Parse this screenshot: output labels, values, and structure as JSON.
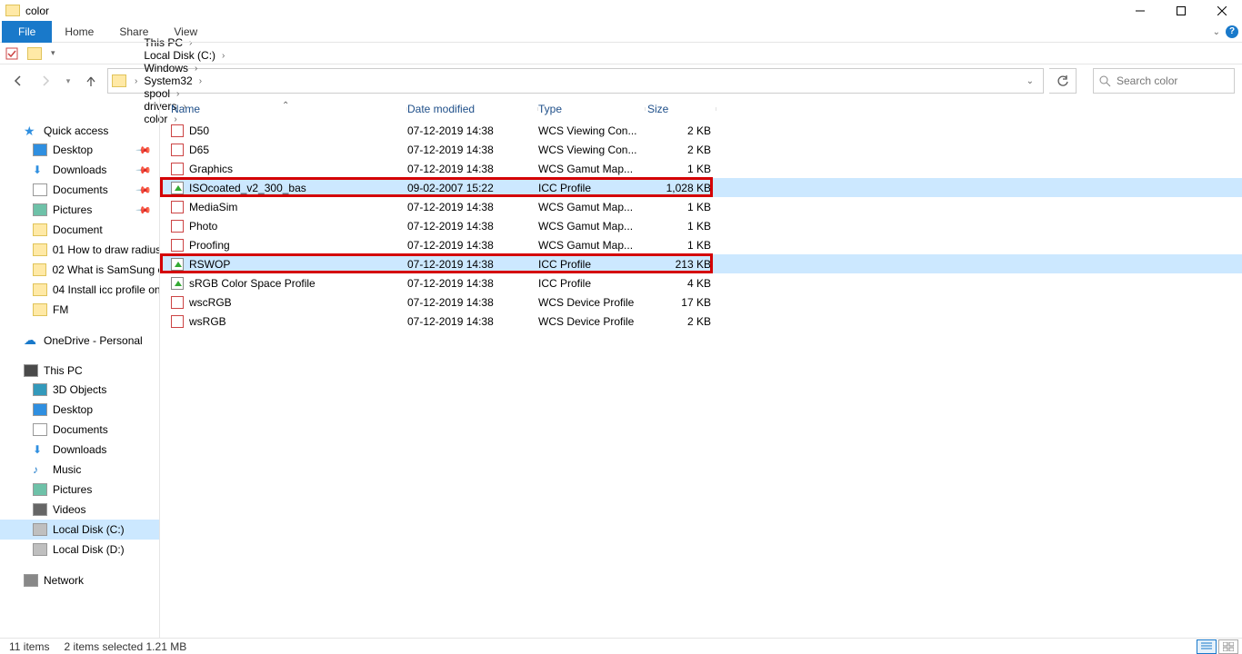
{
  "title": "color",
  "ribbon": {
    "file": "File",
    "home": "Home",
    "share": "Share",
    "view": "View"
  },
  "breadcrumb": [
    "This PC",
    "Local Disk (C:)",
    "Windows",
    "System32",
    "spool",
    "drivers",
    "color"
  ],
  "search_placeholder": "Search color",
  "columns": {
    "name": "Name",
    "date": "Date modified",
    "type": "Type",
    "size": "Size"
  },
  "nav": {
    "quick": "Quick access",
    "pinned": [
      "Desktop",
      "Downloads",
      "Documents",
      "Pictures"
    ],
    "recent": [
      "Document",
      "01 How to draw radius",
      "02 What is SamSung c",
      "04 Install icc profile on",
      "FM"
    ],
    "onedrive": "OneDrive - Personal",
    "thispc": "This PC",
    "pcitems": [
      "3D Objects",
      "Desktop",
      "Documents",
      "Downloads",
      "Music",
      "Pictures",
      "Videos",
      "Local Disk (C:)",
      "Local Disk (D:)"
    ],
    "network": "Network"
  },
  "files": [
    {
      "name": "D50",
      "date": "07-12-2019 14:38",
      "type": "WCS Viewing Con...",
      "size": "2 KB",
      "icon": "wcs",
      "sel": false
    },
    {
      "name": "D65",
      "date": "07-12-2019 14:38",
      "type": "WCS Viewing Con...",
      "size": "2 KB",
      "icon": "wcs",
      "sel": false
    },
    {
      "name": "Graphics",
      "date": "07-12-2019 14:38",
      "type": "WCS Gamut Map...",
      "size": "1 KB",
      "icon": "wcs",
      "sel": false
    },
    {
      "name": "ISOcoated_v2_300_bas",
      "date": "09-02-2007 15:22",
      "type": "ICC Profile",
      "size": "1,028 KB",
      "icon": "icc",
      "sel": true,
      "hl": true
    },
    {
      "name": "MediaSim",
      "date": "07-12-2019 14:38",
      "type": "WCS Gamut Map...",
      "size": "1 KB",
      "icon": "wcs",
      "sel": false
    },
    {
      "name": "Photo",
      "date": "07-12-2019 14:38",
      "type": "WCS Gamut Map...",
      "size": "1 KB",
      "icon": "wcs",
      "sel": false
    },
    {
      "name": "Proofing",
      "date": "07-12-2019 14:38",
      "type": "WCS Gamut Map...",
      "size": "1 KB",
      "icon": "wcs",
      "sel": false
    },
    {
      "name": "RSWOP",
      "date": "07-12-2019 14:38",
      "type": "ICC Profile",
      "size": "213 KB",
      "icon": "icc",
      "sel": true,
      "hl": true
    },
    {
      "name": "sRGB Color Space Profile",
      "date": "07-12-2019 14:38",
      "type": "ICC Profile",
      "size": "4 KB",
      "icon": "icc",
      "sel": false
    },
    {
      "name": "wscRGB",
      "date": "07-12-2019 14:38",
      "type": "WCS Device Profile",
      "size": "17 KB",
      "icon": "wcs",
      "sel": false
    },
    {
      "name": "wsRGB",
      "date": "07-12-2019 14:38",
      "type": "WCS Device Profile",
      "size": "2 KB",
      "icon": "wcs",
      "sel": false
    }
  ],
  "status": {
    "count": "11 items",
    "sel": "2 items selected  1.21 MB"
  }
}
